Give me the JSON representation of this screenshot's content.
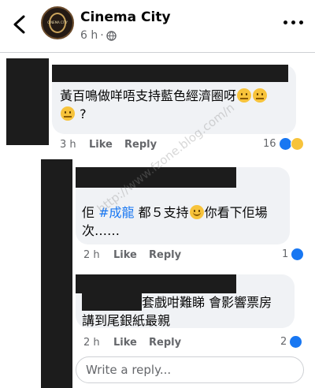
{
  "header": {
    "page_name": "Cinema City",
    "time": "6 h",
    "logo_text": "CINEMA CITY"
  },
  "comments": [
    {
      "text_line1": "黃百鳴做咩唔支持藍色經濟圈呀",
      "text_line2": "?",
      "time": "3 h",
      "like_label": "Like",
      "reply_label": "Reply",
      "reaction_count": "16"
    },
    {
      "pre": "佢 ",
      "hashtag": "#成龍",
      "post": " 都５支持",
      "post2": "你看下佢場",
      "line2": "次……",
      "time": "2 h",
      "like_label": "Like",
      "reply_label": "Reply",
      "reaction_count": "1"
    },
    {
      "line1": "套戲咁難睇 會影響票房",
      "line2": "講到尾銀紙最親",
      "time": "2 h",
      "like_label": "Like",
      "reply_label": "Reply",
      "reaction_count": "2"
    }
  ],
  "reply_input": {
    "placeholder": "Write a reply..."
  },
  "watermark": "http://www.fzone.blog.com/n"
}
